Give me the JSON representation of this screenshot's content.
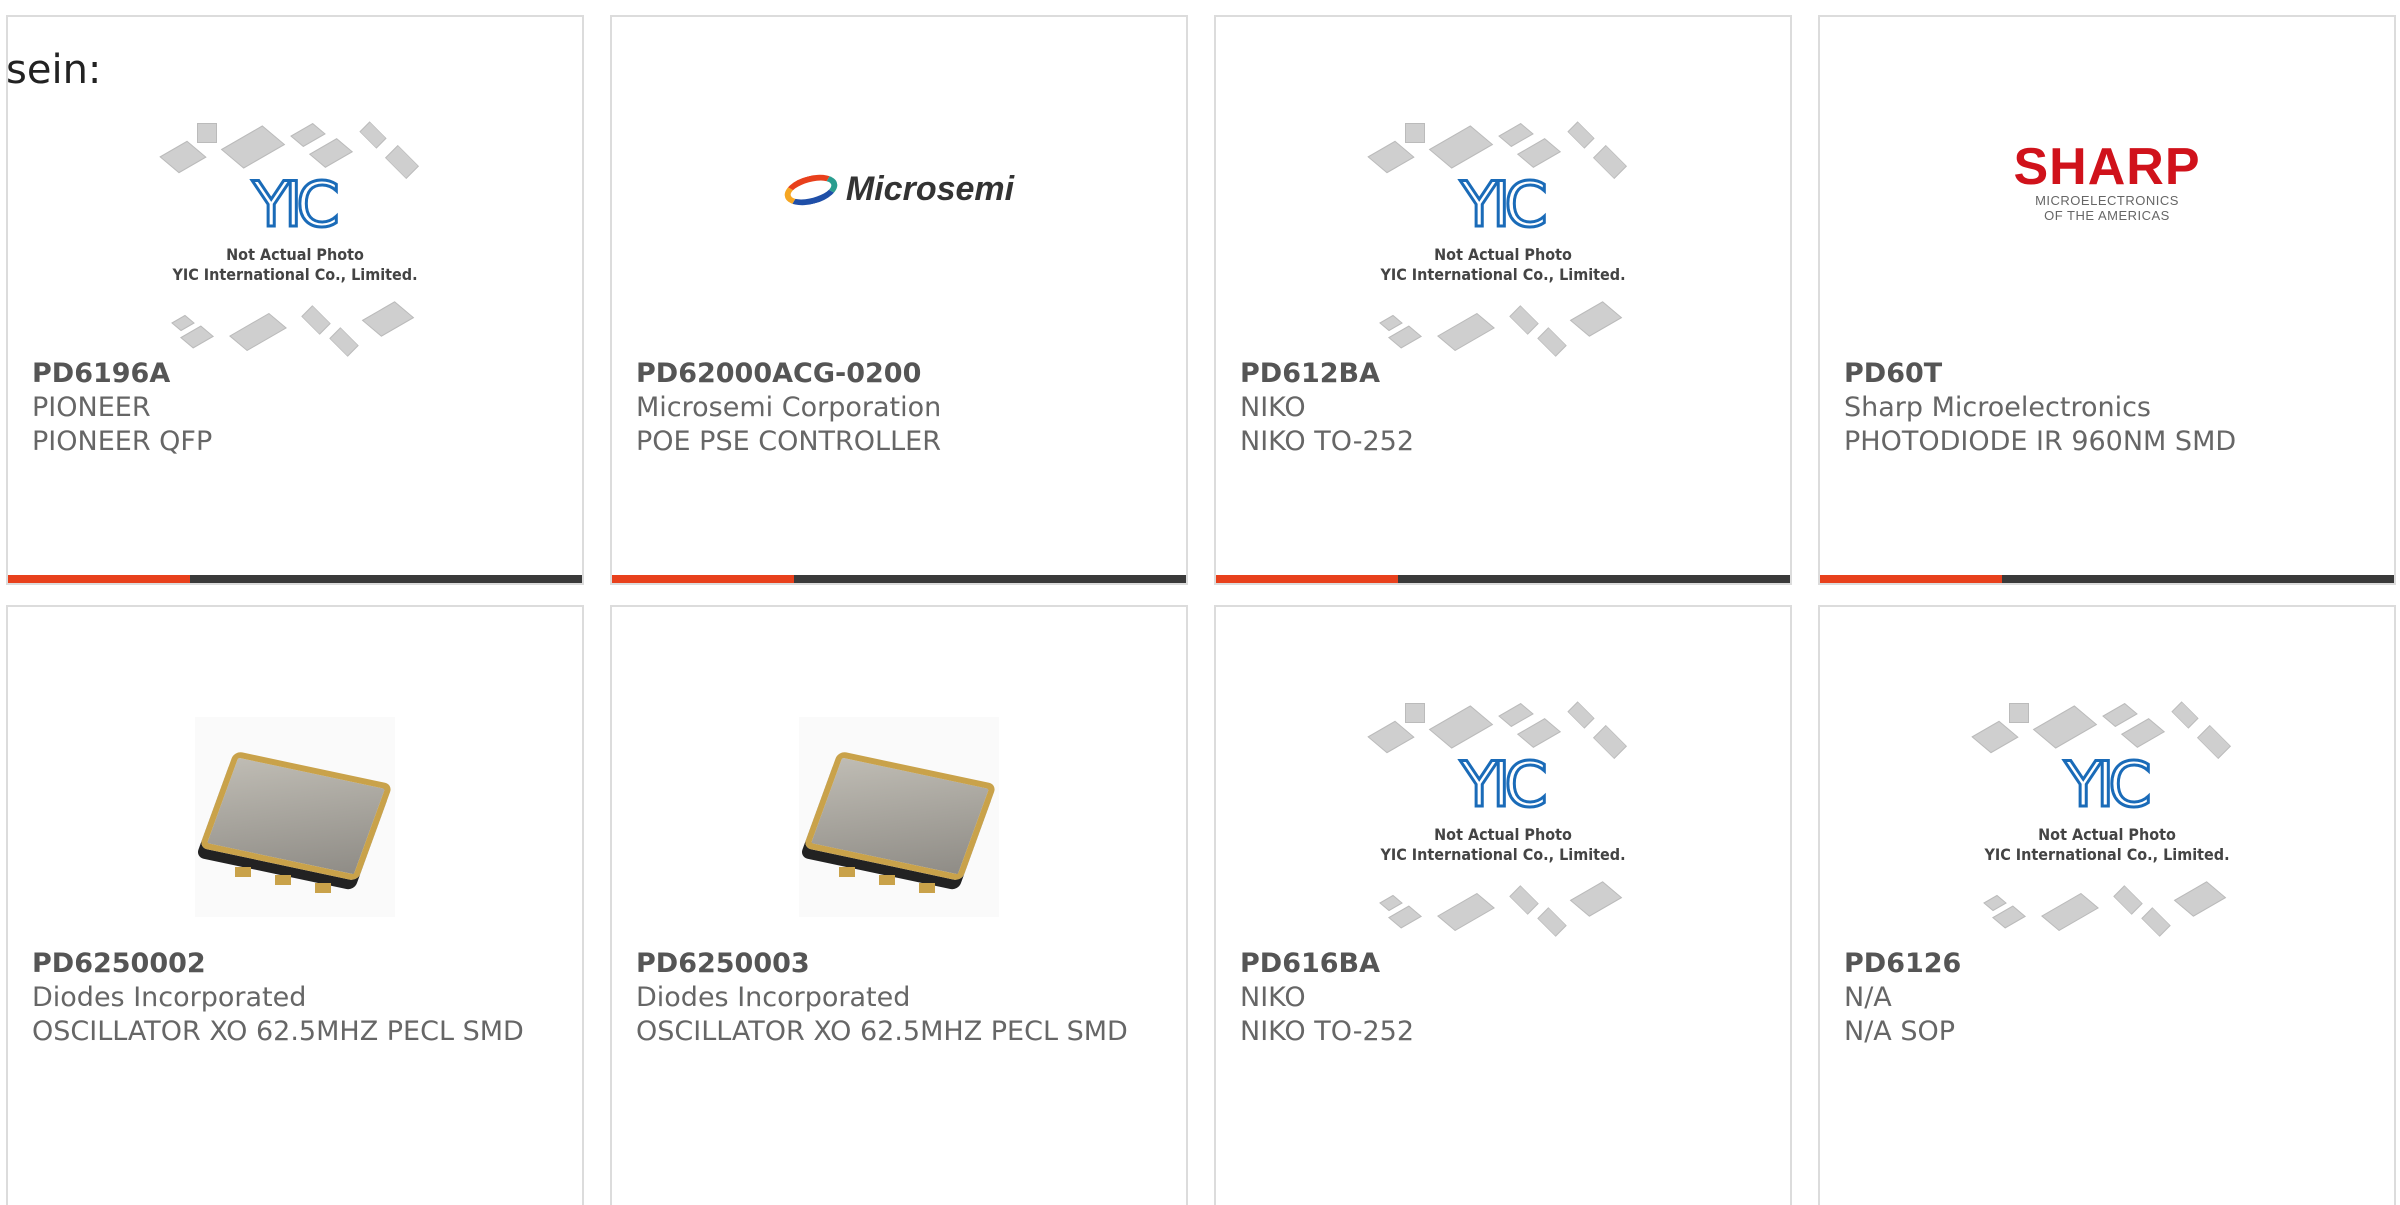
{
  "intro_text": "sein:",
  "placeholder": {
    "logo_text": "YIC",
    "caption_line1": "Not Actual Photo",
    "caption_line2": "YIC International Co., Limited."
  },
  "logos": {
    "microsemi": "Microsemi",
    "sharp_word": "SHARP",
    "sharp_sub1": "MICROELECTRONICS",
    "sharp_sub2": "OF THE AMERICAS"
  },
  "colors": {
    "accent": "#e8401c",
    "bar": "#3a3a3a",
    "card_border": "#dcdcdc"
  },
  "products": [
    {
      "part": "PD6196A",
      "brand": "PIONEER",
      "desc": "PIONEER QFP",
      "image": "placeholder"
    },
    {
      "part": "PD62000ACG-0200",
      "brand": "Microsemi Corporation",
      "desc": "POE PSE CONTROLLER",
      "image": "microsemi-logo"
    },
    {
      "part": "PD612BA",
      "brand": "NIKO",
      "desc": "NIKO TO-252",
      "image": "placeholder"
    },
    {
      "part": "PD60T",
      "brand": "Sharp Microelectronics",
      "desc": "PHOTODIODE IR 960NM SMD",
      "image": "sharp-logo"
    },
    {
      "part": "PD6250002",
      "brand": "Diodes Incorporated",
      "desc": "OSCILLATOR XO 62.5MHZ PECL SMD",
      "image": "oscillator-photo"
    },
    {
      "part": "PD6250003",
      "brand": "Diodes Incorporated",
      "desc": "OSCILLATOR XO 62.5MHZ PECL SMD",
      "image": "oscillator-photo"
    },
    {
      "part": "PD616BA",
      "brand": "NIKO",
      "desc": "NIKO TO-252",
      "image": "placeholder"
    },
    {
      "part": "PD6126",
      "brand": "N/A",
      "desc": "N/A SOP",
      "image": "placeholder"
    }
  ]
}
